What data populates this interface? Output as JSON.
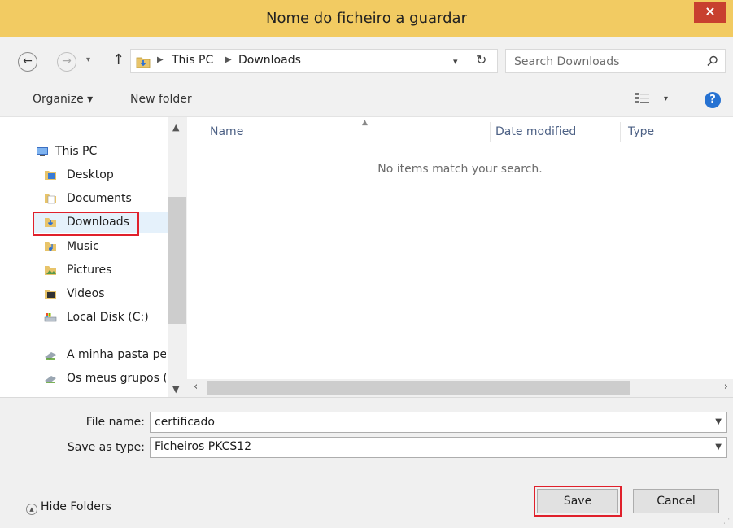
{
  "window": {
    "title": "Nome do ficheiro a guardar",
    "close_glyph": "×"
  },
  "nav": {
    "back_glyph": "←",
    "forward_glyph": "→",
    "up_glyph": "↑",
    "breadcrumb": [
      "This PC",
      "Downloads"
    ],
    "search_placeholder": "Search Downloads"
  },
  "toolbar": {
    "organize": "Organize ▾",
    "new_folder": "New folder",
    "help_glyph": "?"
  },
  "sidebar": {
    "items": [
      {
        "label": "This PC",
        "icon": "computer-icon"
      },
      {
        "label": "Desktop",
        "icon": "desktop-folder-icon"
      },
      {
        "label": "Documents",
        "icon": "documents-folder-icon"
      },
      {
        "label": "Downloads",
        "icon": "downloads-folder-icon",
        "selected": true
      },
      {
        "label": "Music",
        "icon": "music-folder-icon"
      },
      {
        "label": "Pictures",
        "icon": "pictures-folder-icon"
      },
      {
        "label": "Videos",
        "icon": "videos-folder-icon"
      },
      {
        "label": "Local Disk (C:)",
        "icon": "drive-icon"
      },
      {
        "label": "A minha pasta pe",
        "icon": "network-share-icon"
      },
      {
        "label": "Os meus grupos (",
        "icon": "network-share-icon"
      }
    ]
  },
  "filelist": {
    "columns": [
      "Name",
      "Date modified",
      "Type"
    ],
    "empty_message": "No items match your search."
  },
  "form": {
    "filename_label": "File name:",
    "filename_value": "certificado",
    "type_label": "Save as type:",
    "type_value": "Ficheiros PKCS12"
  },
  "footer": {
    "hide_folders": "Hide Folders",
    "save": "Save",
    "cancel": "Cancel"
  },
  "colors": {
    "titlebar": "#f2cb62",
    "close": "#c8402f",
    "highlight_box": "#e0202b",
    "selection": "#e5f1fb"
  }
}
